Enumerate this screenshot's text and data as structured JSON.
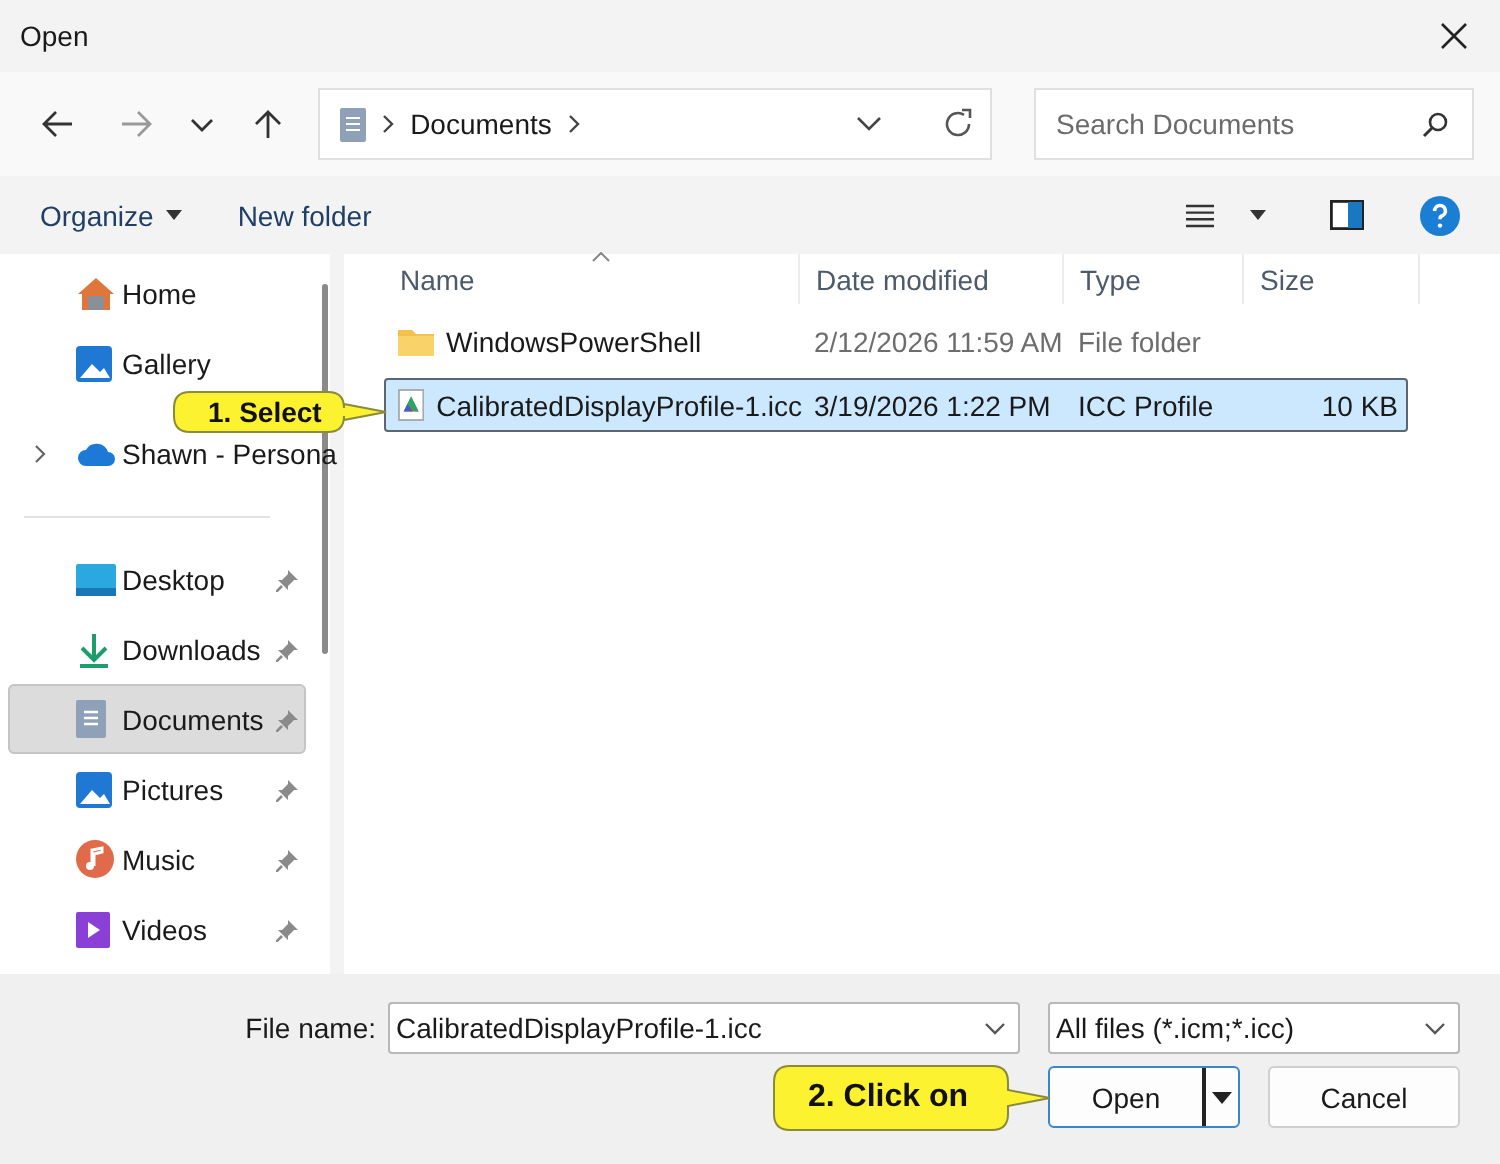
{
  "window": {
    "title": "Open"
  },
  "nav": {
    "path": [
      "Documents"
    ],
    "search": {
      "placeholder": "Search Documents"
    }
  },
  "toolbar": {
    "organize": "Organize",
    "new_folder": "New folder"
  },
  "sidebar": {
    "groups": [
      [
        {
          "label": "Home",
          "kind": "home",
          "pinned": false,
          "expandable": false,
          "selected": false
        },
        {
          "label": "Gallery",
          "kind": "gallery",
          "pinned": false,
          "expandable": false,
          "selected": false
        },
        {
          "label": "Shawn - Persona",
          "kind": "cloud",
          "pinned": false,
          "expandable": true,
          "selected": false
        }
      ],
      [
        {
          "label": "Desktop",
          "kind": "desktop",
          "pinned": true,
          "expandable": false,
          "selected": false
        },
        {
          "label": "Downloads",
          "kind": "downloads",
          "pinned": true,
          "expandable": false,
          "selected": false
        },
        {
          "label": "Documents",
          "kind": "documents",
          "pinned": true,
          "expandable": false,
          "selected": true
        },
        {
          "label": "Pictures",
          "kind": "pictures",
          "pinned": true,
          "expandable": false,
          "selected": false
        },
        {
          "label": "Music",
          "kind": "music",
          "pinned": true,
          "expandable": false,
          "selected": false
        },
        {
          "label": "Videos",
          "kind": "videos",
          "pinned": true,
          "expandable": false,
          "selected": false
        }
      ]
    ]
  },
  "columns": [
    "Name",
    "Date modified",
    "Type",
    "Size"
  ],
  "files": [
    {
      "kind": "folder",
      "name": "WindowsPowerShell",
      "date": "2/12/2026 11:59 AM",
      "type": "File folder",
      "selected": false
    },
    {
      "kind": "profile",
      "name": "CalibratedDisplayProfile-1.icc",
      "date": "3/19/2026 1:22 PM",
      "type": "ICC Profile",
      "size": "10 KB",
      "selected": true
    }
  ],
  "bottom": {
    "file_name_label": "File name:",
    "file_name": "CalibratedDisplayProfile-1.icc",
    "filter": "All files (*.icm;*.icc)",
    "buttons": [
      {
        "label": "Open",
        "kind": "split"
      },
      {
        "label": "Cancel",
        "kind": "plain"
      }
    ]
  },
  "callouts": [
    {
      "text": "1. Select"
    },
    {
      "text": "2. Click on"
    }
  ]
}
